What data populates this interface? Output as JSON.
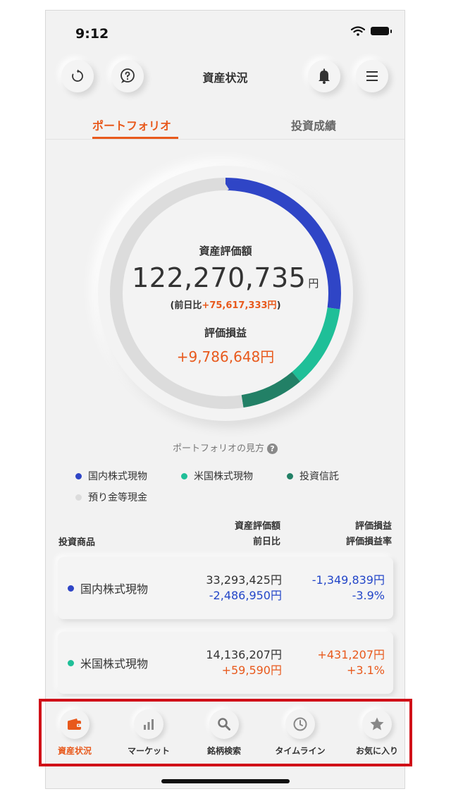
{
  "status_bar": {
    "time": "9:12"
  },
  "header": {
    "title": "資産状況"
  },
  "tabs": [
    {
      "label": "ポートフォリオ",
      "active": true
    },
    {
      "label": "投資成績",
      "active": false
    }
  ],
  "summary": {
    "asset_label": "資産評価額",
    "asset_value": "122,270,735",
    "asset_unit": "円",
    "prev_day_prefix": "(前日比",
    "prev_day_value": "+75,617,333円",
    "prev_day_suffix": ")",
    "gain_label": "評価損益",
    "gain_value": "+9,786,648円"
  },
  "donut": {
    "segments": [
      {
        "name": "国内株式現物",
        "fraction": 0.272,
        "color": "#2f45c6"
      },
      {
        "name": "米国株式現物",
        "fraction": 0.116,
        "color": "#1fbf98"
      },
      {
        "name": "投資信託",
        "fraction": 0.087,
        "color": "#228066"
      },
      {
        "name": "預り金等現金",
        "fraction": 0.525,
        "color": "#dcdcdc"
      }
    ]
  },
  "legend": {
    "howto_label": "ポートフォリオの見方",
    "items": [
      {
        "label": "国内株式現物",
        "color": "#2f45c6"
      },
      {
        "label": "米国株式現物",
        "color": "#1fbf98"
      },
      {
        "label": "投資信託",
        "color": "#228066"
      },
      {
        "label": "預り金等現金",
        "color": "#dcdcdc"
      }
    ]
  },
  "table": {
    "headers": {
      "product": "投資商品",
      "valuation": "資産評価額",
      "prev_day": "前日比",
      "gain": "評価損益",
      "gain_rate": "評価損益率"
    },
    "rows": [
      {
        "name": "国内株式現物",
        "color": "#2f45c6",
        "valuation": "33,293,425円",
        "prev_day": "-2,486,950円",
        "gain": "-1,349,839円",
        "gain_rate": "-3.9%"
      },
      {
        "name": "米国株式現物",
        "color": "#1fbf98",
        "valuation": "14,136,207円",
        "prev_day": "+59,590円",
        "gain": "+431,207円",
        "gain_rate": "+3.1%"
      }
    ]
  },
  "bottom_nav": [
    {
      "label": "資産状況",
      "icon": "wallet-icon",
      "active": true
    },
    {
      "label": "マーケット",
      "icon": "bar-chart-icon",
      "active": false
    },
    {
      "label": "銘柄検索",
      "icon": "search-icon",
      "active": false
    },
    {
      "label": "タイムライン",
      "icon": "clock-icon",
      "active": false
    },
    {
      "label": "お気に入り",
      "icon": "star-icon",
      "active": false
    }
  ],
  "colors": {
    "accent": "#e8591c",
    "negative": "#2346c8",
    "highlight_border": "#d01018"
  }
}
